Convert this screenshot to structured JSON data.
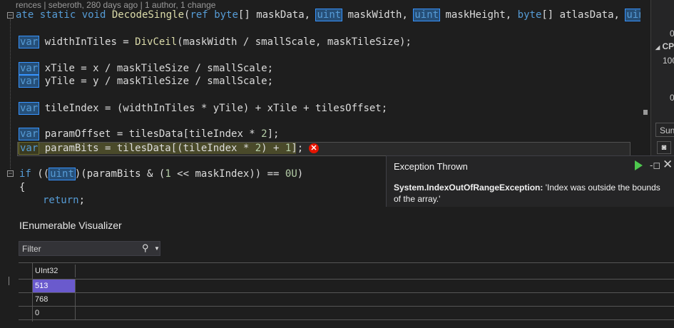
{
  "editor": {
    "codelens": "rences | seberoth, 280 days ago | 1 author, 1 change",
    "lines": {
      "sig_prefix": "ate static void ",
      "sig_fn": "DecodeSingle",
      "sig_ref": "ref",
      "sig_byte1": "byte",
      "sig_a": "[] maskData, ",
      "sig_uint1": "uint",
      "sig_b": " maskWidth, ",
      "sig_uint2": "uint",
      "sig_c": " maskHeight, ",
      "sig_byte2": "byte",
      "sig_d": "[] atlasData, ",
      "sig_uint3": "uin",
      "l1_var": "var",
      "l1_a": " widthInTiles = ",
      "l1_fn": "DivCeil",
      "l1_b": "(maskWidth / smallScale, maskTileSize);",
      "l2_var": "var",
      "l2_a": " xTile = x / maskTileSize / smallScale;",
      "l3_var": "var",
      "l3_a": " yTile = y / maskTileSize / smallScale;",
      "l4_var": "var",
      "l4_a": " tileIndex = (widthInTiles * yTile) + xTile + tilesOffset;",
      "l5_var": "var",
      "l5_a": " paramOffset = tilesData[tileIndex * ",
      "l5_num": "2",
      "l5_b": "];",
      "l6_var": "var",
      "l6_a": " paramBits = tilesData[(tileIndex * ",
      "l6_num": "2",
      "l6_b": ") + ",
      "l6_num2": "1",
      "l6_c": "];",
      "l7_if": "if",
      "l7_a": " ((",
      "l7_uint": "uint",
      "l7_b": ")(paramBits & (",
      "l7_num": "1",
      "l7_c": " << maskIndex)) == ",
      "l7_num2": "0U",
      "l7_d": ")",
      "l8": "{",
      "l9_ret": "return",
      "l9_a": ";"
    }
  },
  "side_panel": {
    "t1": "0",
    "t2": "CP",
    "t3": "100",
    "t4": "0",
    "t5": "Sun"
  },
  "exception": {
    "title": "Exception Thrown",
    "type": "System.IndexOutOfRangeException:",
    "message": " 'Index was outside the bounds of the array.'"
  },
  "visualizer": {
    "title": "IEnumerable Visualizer",
    "filter_placeholder": "Filter",
    "column_header": "UInt32",
    "rows": [
      "513",
      "768",
      "0"
    ]
  },
  "colors": {
    "error": "#e51400",
    "selection": "#6a5acd",
    "keyword": "#569cd6",
    "function": "#dcdcaa"
  }
}
